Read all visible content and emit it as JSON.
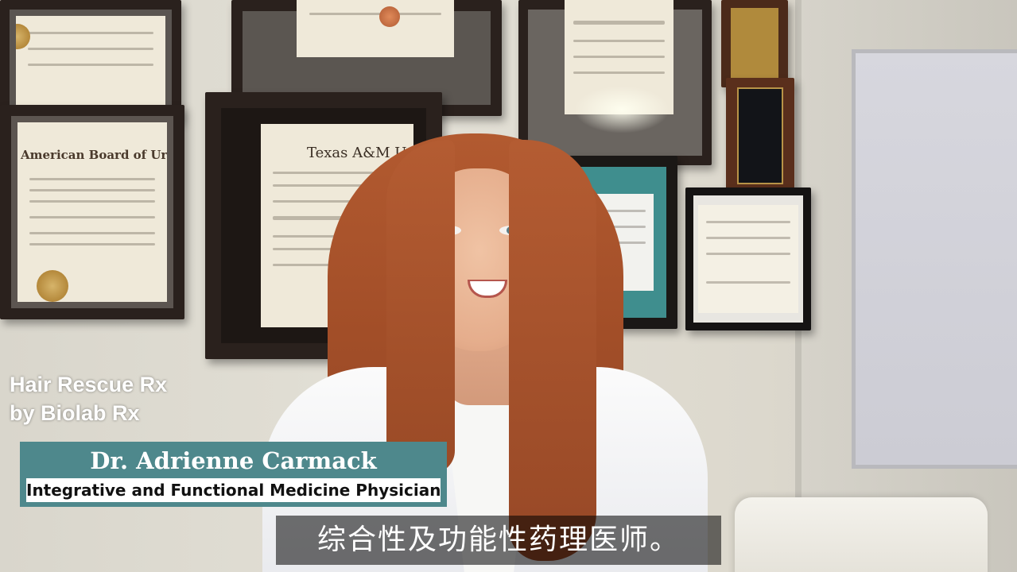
{
  "overlay": {
    "brand_line1": "Hair Rescue Rx",
    "brand_line2": "by Biolab Rx",
    "presenter_name": "Dr. Adrienne Carmack",
    "presenter_title": "Integrative and Functional Medicine Physician",
    "subtitle": "综合性及功能性药理医师。",
    "lower_third_color": "#4e888c"
  },
  "wall": {
    "urology_heading": "American Board of Urology",
    "texas_heading": "Texas A&M Unive"
  }
}
